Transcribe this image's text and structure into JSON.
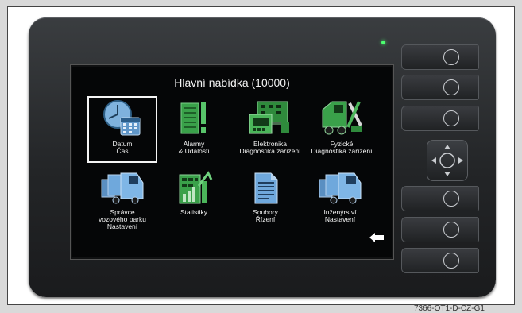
{
  "screen": {
    "title": "Hlavní nabídka (10000)"
  },
  "menu": [
    {
      "lines": [
        "Datum",
        "Čas"
      ],
      "icon": "clock-calendar-icon"
    },
    {
      "lines": [
        "Alarmy",
        "& Události"
      ],
      "icon": "alarm-list-icon"
    },
    {
      "lines": [
        "Elektronika",
        "Diagnostika zařízení"
      ],
      "icon": "electronics-icon"
    },
    {
      "lines": [
        "Fyzické",
        "Diagnostika zařízení"
      ],
      "icon": "vehicle-tools-icon"
    },
    {
      "lines": [
        "Správce",
        "vozového parku",
        "Nastavení"
      ],
      "icon": "truck-icon"
    },
    {
      "lines": [
        "Statistiky"
      ],
      "icon": "statistics-chart-icon"
    },
    {
      "lines": [
        "Soubory",
        "Řízení"
      ],
      "icon": "document-icon"
    },
    {
      "lines": [
        "Inženýrství",
        "Nastavení"
      ],
      "icon": "truck-settings-icon"
    }
  ],
  "selected_index": 0,
  "figure_code": "7366-OT1-D-CZ-G1",
  "colors": {
    "accent_blue": "#6fa8dc",
    "accent_green": "#3aa14a",
    "background": "#050607"
  }
}
